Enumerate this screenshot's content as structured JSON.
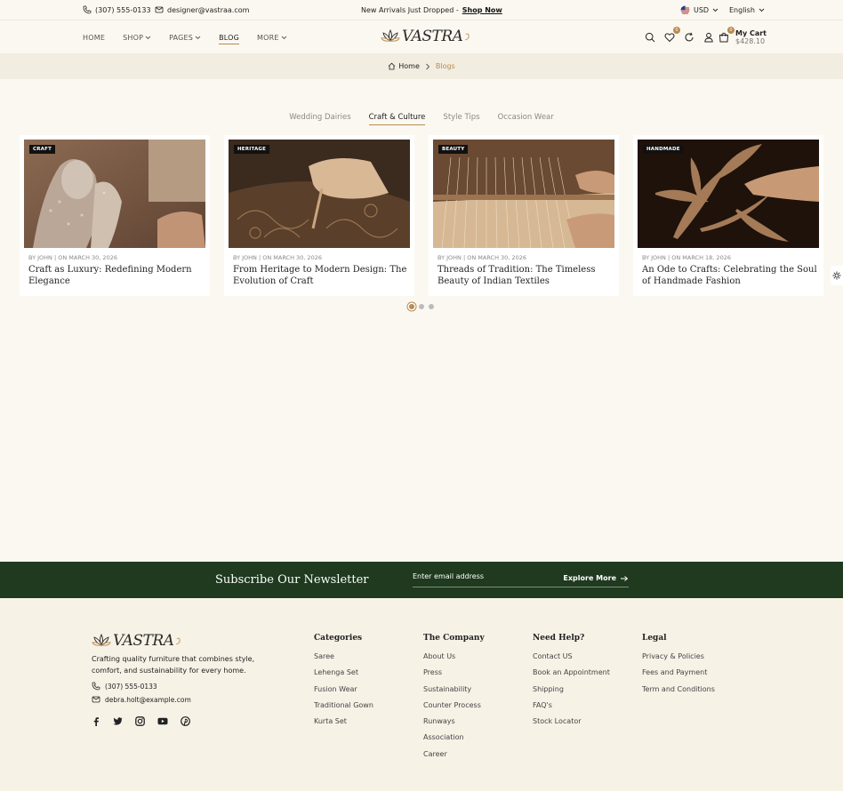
{
  "topbar": {
    "phone": "(307) 555-0133",
    "email": "designer@vastraa.com",
    "announcement": "New Arrivals Just Dropped - ",
    "announcement_link": "Shop Now",
    "currency": "USD",
    "language": "English"
  },
  "nav": {
    "items": [
      {
        "label": "HOME"
      },
      {
        "label": "SHOP"
      },
      {
        "label": "PAGES"
      },
      {
        "label": "BLOG"
      },
      {
        "label": "MORE"
      }
    ],
    "logo_text": "VASTRA",
    "wishlist_count": "0",
    "cart_count": "0",
    "cart_label": "My Cart",
    "cart_total": "$428.10"
  },
  "breadcrumb": {
    "home": "Home",
    "current": "Blogs"
  },
  "tabs": [
    {
      "label": "Wedding Dairies"
    },
    {
      "label": "Craft & Culture"
    },
    {
      "label": "Style Tips"
    },
    {
      "label": "Occasion Wear"
    }
  ],
  "posts": [
    {
      "tag": "CRAFT",
      "meta": "BY JOHN | ON MARCH 30, 2026",
      "title": "Craft as Luxury: Redefining Modern Elegance"
    },
    {
      "tag": "HERITAGE",
      "meta": "BY JOHN | ON MARCH 30, 2026",
      "title": "From Heritage to Modern Design: The Evolution of Craft"
    },
    {
      "tag": "BEAUTY",
      "meta": "BY JOHN | ON MARCH 30, 2026",
      "title": "Threads of Tradition: The Timeless Beauty of Indian Textiles"
    },
    {
      "tag": "HANDMADE",
      "meta": "BY JOHN | ON MARCH 18, 2026",
      "title": "An Ode to Crafts: Celebrating the Soul of Handmade Fashion"
    }
  ],
  "newsletter": {
    "heading": "Subscribe Our Newsletter",
    "placeholder": "Enter email address",
    "button": "Explore More"
  },
  "footer": {
    "logo_text": "VASTRA",
    "description": "Crafting quality furniture that combines style, comfort, and sustainability for every home.",
    "phone": "(307) 555-0133",
    "email": "debra.holt@example.com",
    "columns": [
      {
        "heading": "Categories",
        "links": [
          "Saree",
          "Lehenga Set",
          "Fusion Wear",
          "Traditional Gown",
          "Kurta Set"
        ]
      },
      {
        "heading": "The Company",
        "links": [
          "About Us",
          "Press",
          "Sustainability",
          "Counter Process",
          "Runways",
          "Association",
          "Career"
        ]
      },
      {
        "heading": "Need Help?",
        "links": [
          "Contact US",
          "Book an Appointment",
          "Shipping",
          "FAQ's",
          "Stock Locator"
        ]
      },
      {
        "heading": "Legal",
        "links": [
          "Privacy & Policies",
          "Fees and Payment",
          "Term and Conditions"
        ]
      }
    ]
  },
  "colors": {
    "accent": "#b88a4f",
    "newsletter_bg": "#1f3a1f",
    "page_bg": "#fbf8f1"
  }
}
